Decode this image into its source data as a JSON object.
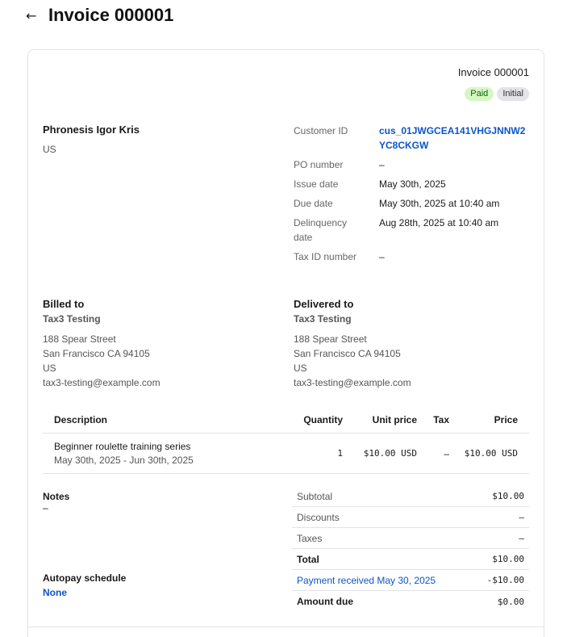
{
  "header": {
    "title": "Invoice 000001",
    "back_icon": "arrow-left-icon"
  },
  "invoice": {
    "number": "Invoice 000001",
    "badges": [
      {
        "label": "Paid",
        "color": "#d7f7c2"
      },
      {
        "label": "Initial",
        "color": "#e3e3e8"
      }
    ],
    "customer": {
      "name": "Phronesis Igor Kris",
      "country": "US"
    },
    "meta": [
      {
        "label": "Customer ID",
        "value": "cus_01JWGCEA141VHGJNNW2YC8CKGW"
      },
      {
        "label": "PO number",
        "value": "–"
      },
      {
        "label": "Issue date",
        "value": "May 30th, 2025"
      },
      {
        "label": "Due date",
        "value": "May 30th, 2025 at 10:40 am"
      },
      {
        "label": "Delinquency date",
        "value": "Aug 28th, 2025 at 10:40 am"
      },
      {
        "label": "Tax ID number",
        "value": "–"
      }
    ],
    "billed_to": {
      "title": "Billed to",
      "company": "Tax3 Testing",
      "street": "188 Spear Street",
      "city": "San Francisco CA 94105",
      "country": "US",
      "email": "tax3-testing@example.com"
    },
    "delivered_to": {
      "title": "Delivered to",
      "company": "Tax3 Testing",
      "street": "188 Spear Street",
      "city": "San Francisco CA 94105",
      "country": "US",
      "email": "tax3-testing@example.com"
    },
    "items": {
      "headers": {
        "description": "Description",
        "quantity": "Quantity",
        "unit_price": "Unit price",
        "tax": "Tax",
        "price": "Price"
      },
      "rows": [
        {
          "description": "Beginner roulette training series",
          "period": "May 30th, 2025 - Jun 30th, 2025",
          "quantity": "1",
          "unit_price": "$10.00 USD",
          "tax": "–",
          "price": "$10.00 USD"
        }
      ]
    },
    "notes": {
      "title": "Notes",
      "value": "–"
    },
    "autopay": {
      "title": "Autopay schedule",
      "value": "None"
    },
    "totals": [
      {
        "label": "Subtotal",
        "value": "$10.00"
      },
      {
        "label": "Discounts",
        "value": "–"
      },
      {
        "label": "Taxes",
        "value": "–"
      },
      {
        "label": "Total",
        "value": "$10.00"
      },
      {
        "label": "Payment received May 30, 2025",
        "value": "-$10.00"
      },
      {
        "label": "Amount due",
        "value": "$0.00"
      }
    ],
    "link_color": "#0b55c9"
  }
}
